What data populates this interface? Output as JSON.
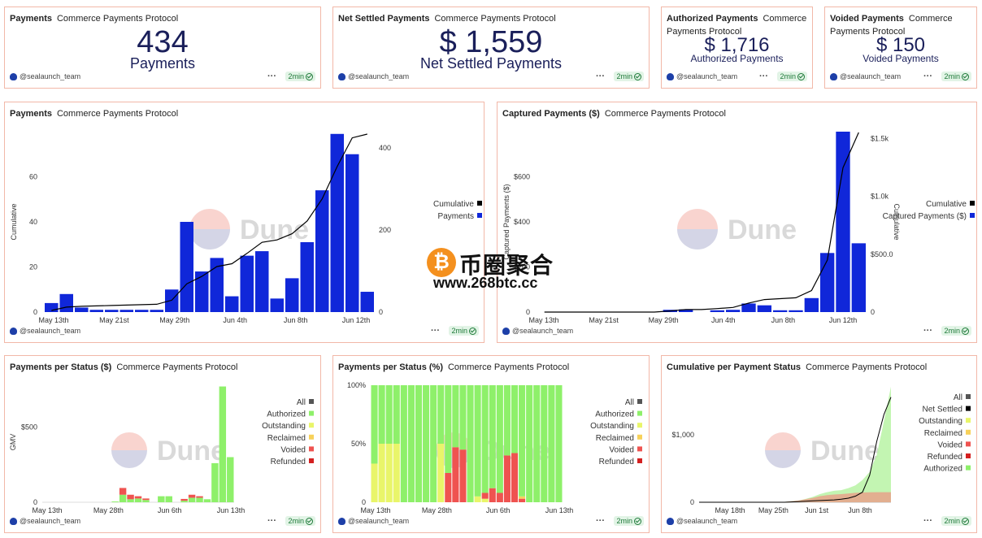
{
  "common": {
    "author": "@sealaunch_team",
    "freshness": "2min",
    "menu": "···",
    "project": "Commerce Payments Protocol"
  },
  "counters": [
    {
      "title": "Payments",
      "value": "434",
      "label": "Payments"
    },
    {
      "title": "Net Settled Payments",
      "value": "$ 1,559",
      "label": "Net Settled Payments"
    },
    {
      "title": "Authorized Payments",
      "value": "$ 1,716",
      "label": "Authorized Payments"
    },
    {
      "title": "Voided Payments",
      "value": "$ 150",
      "label": "Voided Payments"
    }
  ],
  "watermark": {
    "text": "Dune"
  },
  "site_logo": {
    "coin_symbol": "₿",
    "name": "币圈聚合",
    "url": "www.268btc.cc"
  },
  "chart_data": [
    {
      "title": "Payments",
      "subtitle": "Commerce Payments Protocol",
      "type": "bar",
      "bar_color": "#1027d9",
      "line_color": "#000000",
      "x_ticks": [
        "May 13th",
        "May 21st",
        "May 29th",
        "Jun 4th",
        "Jun 8th",
        "Jun 12th"
      ],
      "ylabel_left": "Cumulative",
      "y_left_ticks": [
        0,
        20,
        40,
        60
      ],
      "y_right_ticks": [
        0,
        200,
        400
      ],
      "legend": [
        "Cumulative",
        "Payments"
      ],
      "series": [
        {
          "name": "Payments",
          "values": [
            4,
            8,
            2,
            1,
            1,
            1,
            1,
            1,
            10,
            40,
            18,
            24,
            7,
            25,
            27,
            6,
            15,
            31,
            54,
            79,
            70,
            9
          ]
        },
        {
          "name": "Cumulative",
          "values": [
            4,
            12,
            14,
            15,
            16,
            17,
            18,
            19,
            29,
            69,
            87,
            111,
            118,
            143,
            170,
            176,
            191,
            222,
            276,
            355,
            425,
            434
          ]
        }
      ]
    },
    {
      "title": "Captured Payments ($)",
      "subtitle": "Commerce Payments Protocol",
      "type": "bar",
      "bar_color": "#1027d9",
      "line_color": "#000000",
      "x_ticks": [
        "May 13th",
        "May 21st",
        "May 29th",
        "Jun 4th",
        "Jun 8th",
        "Jun 12th"
      ],
      "ylabel_left": "Captured Payments ($)",
      "ylabel_right": "Cumulative",
      "y_left_ticks": [
        "0",
        "$200",
        "$400",
        "$600"
      ],
      "y_right_ticks": [
        "0",
        "$500.0",
        "$1.0k",
        "$1.5k"
      ],
      "legend": [
        "Cumulative",
        "Captured Payments ($)"
      ],
      "series": [
        {
          "name": "Captured Payments ($)",
          "values": [
            0,
            0,
            0,
            0,
            0,
            0,
            0,
            0,
            10,
            12,
            0,
            8,
            10,
            38,
            30,
            8,
            8,
            62,
            262,
            800,
            305
          ]
        },
        {
          "name": "Cumulative",
          "values": [
            0,
            0,
            0,
            0,
            0,
            0,
            0,
            0,
            10,
            22,
            22,
            30,
            40,
            78,
            108,
            116,
            124,
            186,
            448,
            1248,
            1553
          ]
        }
      ]
    },
    {
      "title": "Payments per Status ($)",
      "subtitle": "Commerce Payments Protocol",
      "type": "bar",
      "x_ticks": [
        "May 13th",
        "May 28th",
        "Jun 6th",
        "Jun 13th"
      ],
      "ylabel": "GMV",
      "y_ticks": [
        "0",
        "$500"
      ],
      "legend": [
        {
          "name": "All",
          "color": "#555555"
        },
        {
          "name": "Authorized",
          "color": "#8ef06a"
        },
        {
          "name": "Outstanding",
          "color": "#e9f56a"
        },
        {
          "name": "Reclaimed",
          "color": "#f7d15a"
        },
        {
          "name": "Voided",
          "color": "#ef5350"
        },
        {
          "name": "Refunded",
          "color": "#d42020"
        }
      ],
      "series": [
        {
          "name": "Authorized",
          "values": [
            0,
            0,
            0,
            0,
            0,
            0,
            0,
            0,
            0,
            5,
            50,
            20,
            25,
            15,
            0,
            40,
            40,
            0,
            10,
            30,
            30,
            20,
            260,
            770,
            300
          ]
        },
        {
          "name": "Voided",
          "values": [
            0,
            0,
            0,
            0,
            0,
            0,
            0,
            0,
            0,
            0,
            45,
            30,
            15,
            10,
            0,
            0,
            0,
            0,
            12,
            20,
            10,
            0,
            0,
            0,
            0
          ]
        }
      ]
    },
    {
      "title": "Payments per Status (%)",
      "subtitle": "Commerce Payments Protocol",
      "type": "bar",
      "x_ticks": [
        "May 13th",
        "May 28th",
        "Jun 6th",
        "Jun 13th"
      ],
      "y_ticks": [
        "0",
        "50%",
        "100%"
      ],
      "legend": [
        {
          "name": "All",
          "color": "#555555"
        },
        {
          "name": "Authorized",
          "color": "#8ef06a"
        },
        {
          "name": "Outstanding",
          "color": "#e9f56a"
        },
        {
          "name": "Reclaimed",
          "color": "#f7d15a"
        },
        {
          "name": "Voided",
          "color": "#ef5350"
        },
        {
          "name": "Refunded",
          "color": "#d42020"
        }
      ],
      "series": [
        {
          "name": "Outstanding",
          "values": [
            33,
            50,
            50,
            50,
            0,
            0,
            0,
            0,
            0,
            50,
            0,
            0,
            0,
            0,
            5,
            3,
            0,
            0,
            0,
            0,
            0,
            0,
            0,
            0,
            0,
            0
          ]
        },
        {
          "name": "Voided",
          "values": [
            0,
            0,
            0,
            0,
            0,
            0,
            0,
            0,
            0,
            0,
            25,
            47,
            45,
            0,
            0,
            5,
            12,
            8,
            40,
            42,
            3,
            0,
            0,
            0,
            0,
            0
          ]
        },
        {
          "name": "Reclaimed",
          "values": [
            0,
            0,
            0,
            0,
            0,
            0,
            0,
            0,
            0,
            0,
            0,
            0,
            0,
            0,
            0,
            0,
            0,
            0,
            0,
            0,
            2,
            0,
            0,
            0,
            0,
            0
          ]
        },
        {
          "name": "Authorized",
          "values": [
            67,
            50,
            50,
            50,
            100,
            100,
            100,
            100,
            100,
            50,
            75,
            53,
            55,
            100,
            95,
            92,
            88,
            92,
            60,
            58,
            95,
            100,
            100,
            100,
            100,
            100
          ]
        }
      ]
    },
    {
      "title": "Cumulative per Payment Status",
      "subtitle": "Commerce Payments Protocol",
      "type": "area",
      "x_ticks": [
        "May 18th",
        "May 25th",
        "Jun 1st",
        "Jun 8th"
      ],
      "y_ticks": [
        "0",
        "$1,000"
      ],
      "legend": [
        {
          "name": "All",
          "color": "#555555"
        },
        {
          "name": "Net Settled",
          "color": "#000000"
        },
        {
          "name": "Outstanding",
          "color": "#e9f56a"
        },
        {
          "name": "Reclaimed",
          "color": "#f7d15a"
        },
        {
          "name": "Voided",
          "color": "#ef5350"
        },
        {
          "name": "Refunded",
          "color": "#d42020"
        },
        {
          "name": "Authorized",
          "color": "#8ef06a"
        }
      ],
      "series": [
        {
          "name": "Authorized",
          "values": [
            0,
            0,
            0,
            0,
            0,
            0,
            0,
            0,
            0,
            0,
            0,
            0,
            5,
            15,
            25,
            50,
            80,
            120,
            150,
            170,
            180,
            210,
            250,
            330,
            450,
            700,
            1200,
            1716
          ]
        },
        {
          "name": "Voided",
          "values": [
            0,
            0,
            0,
            0,
            0,
            0,
            0,
            0,
            0,
            0,
            0,
            0,
            5,
            15,
            25,
            45,
            65,
            90,
            105,
            115,
            120,
            130,
            140,
            145,
            148,
            150,
            150,
            150
          ]
        },
        {
          "name": "Net Settled",
          "values": [
            0,
            0,
            0,
            0,
            0,
            0,
            0,
            0,
            0,
            0,
            0,
            0,
            0,
            5,
            10,
            15,
            20,
            25,
            30,
            35,
            45,
            60,
            90,
            150,
            400,
            900,
            1300,
            1559
          ]
        }
      ]
    }
  ]
}
